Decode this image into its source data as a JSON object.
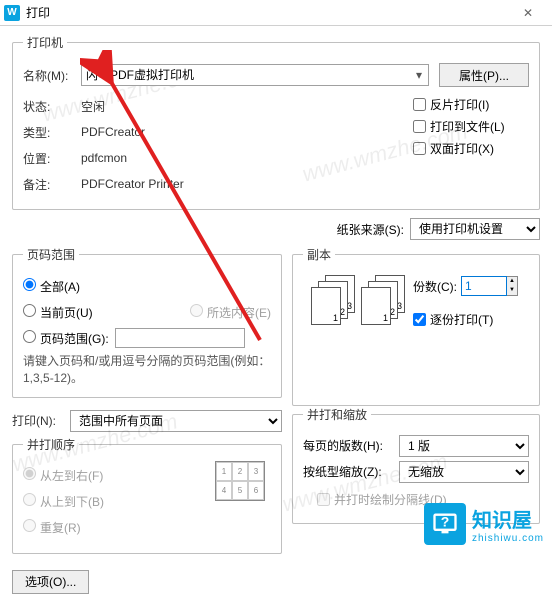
{
  "window": {
    "title": "打印"
  },
  "printer_group": {
    "legend": "打印机",
    "name_label": "名称(M):",
    "name_value": "闪电PDF虚拟打印机",
    "properties_btn": "属性(P)...",
    "status_label": "状态:",
    "status_value": "空闲",
    "type_label": "类型:",
    "type_value": "PDFCreator",
    "where_label": "位置:",
    "where_value": "pdfcmon",
    "comment_label": "备注:",
    "comment_value": "PDFCreator Printer",
    "reverse": "反片打印(I)",
    "tofile": "打印到文件(L)",
    "duplex": "双面打印(X)"
  },
  "source": {
    "label": "纸张来源(S):",
    "value": "使用打印机设置"
  },
  "range": {
    "legend": "页码范围",
    "all": "全部(A)",
    "current": "当前页(U)",
    "selection": "所选内容(E)",
    "pages": "页码范围(G):",
    "hint": "请键入页码和/或用逗号分隔的页码范围(例如：1,3,5-12)。"
  },
  "copies": {
    "legend": "副本",
    "count_label": "份数(C):",
    "count_value": "1",
    "collate": "逐份打印(T)"
  },
  "print": {
    "label": "打印(N):",
    "value": "范围中所有页面"
  },
  "order": {
    "legend": "并打顺序",
    "lr": "从左到右(F)",
    "tb": "从上到下(B)",
    "repeat": "重复(R)"
  },
  "scale": {
    "legend": "并打和缩放",
    "per_label": "每页的版数(H):",
    "per_value": "1 版",
    "zoom_label": "按纸型缩放(Z):",
    "zoom_value": "无缩放",
    "drawline": "并打时绘制分隔线(D)"
  },
  "options_btn": "选项(O)...",
  "logo": {
    "cn": "知识屋",
    "py": "zhishiwu.com"
  }
}
